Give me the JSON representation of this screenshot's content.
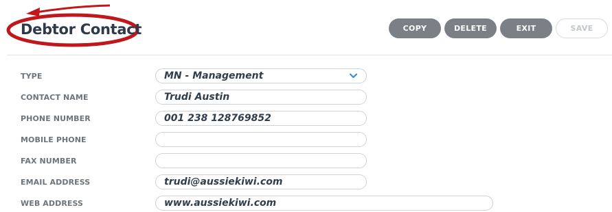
{
  "header": {
    "title": "Debtor Contact",
    "buttons": {
      "copy": "COPY",
      "delete": "DELETE",
      "exit": "EXIT",
      "save": "SAVE"
    }
  },
  "form": {
    "type": {
      "label": "TYPE",
      "value": "MN - Management"
    },
    "contact_name": {
      "label": "CONTACT NAME",
      "value": "Trudi Austin"
    },
    "phone_number": {
      "label": "PHONE NUMBER",
      "value": "001 238 128769852"
    },
    "mobile_phone": {
      "label": "MOBILE PHONE",
      "value": ""
    },
    "fax_number": {
      "label": "FAX NUMBER",
      "value": ""
    },
    "email_address": {
      "label": "EMAIL ADDRESS",
      "value": "trudi@aussiekiwi.com"
    },
    "web_address": {
      "label": "WEB ADDRESS",
      "value": "www.aussiekiwi.com"
    }
  },
  "colors": {
    "button": "#7b8086",
    "annotation": "#c0171d",
    "accent_chevron": "#3a8ddb"
  },
  "icons": {
    "select_chevron": "chevron-down-icon",
    "annotation_arrow": "red-arrow-annotation"
  }
}
